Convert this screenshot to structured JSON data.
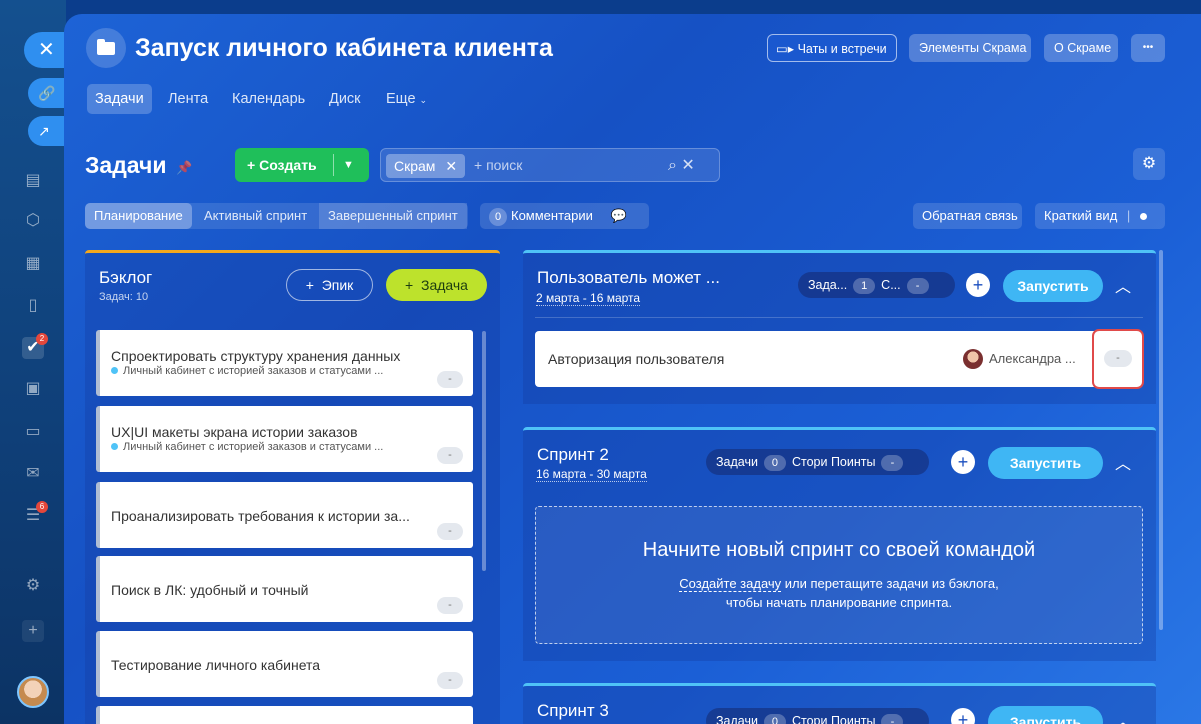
{
  "rail": {
    "chat_badge": "2",
    "feed_badge": "6"
  },
  "header": {
    "title": "Запуск личного кабинета клиента",
    "chats_btn": "Чаты и встречи",
    "scrum_elements_btn": "Элементы Скрама",
    "about_scrum_btn": "О Скраме",
    "more_btn": "•••"
  },
  "tabs": [
    {
      "label": "Задачи"
    },
    {
      "label": "Лента"
    },
    {
      "label": "Календарь"
    },
    {
      "label": "Диск"
    },
    {
      "label": "Еще"
    }
  ],
  "toolbar": {
    "section_title": "Задачи",
    "create_label": "Создать",
    "filter_chip": "Скрам",
    "search_placeholder": "+ поиск"
  },
  "views": {
    "planning": "Планирование",
    "active_sprint": "Активный спринт",
    "completed_sprint": "Завершенный спринт",
    "comments_count": "0",
    "comments_label": "Комментарии",
    "feedback": "Обратная связь",
    "compact_view": "Краткий вид"
  },
  "backlog": {
    "title": "Бэклог",
    "subtitle": "Задач: 10",
    "epic_btn": "Эпик",
    "task_btn": "Задача",
    "cards": [
      {
        "title": "Спроектировать структуру хранения данных",
        "epic": "Личный кабинет с историей заказов и статусами ...",
        "points": "-"
      },
      {
        "title": "UX|UI макеты экрана истории заказов",
        "epic": "Личный кабинет с историей заказов и статусами ...",
        "points": "-"
      },
      {
        "title": "Проанализировать требования к истории за...",
        "epic": "",
        "points": "-"
      },
      {
        "title": "Поиск в ЛК: удобный и точный",
        "epic": "",
        "points": "-"
      },
      {
        "title": "Тестирование личного кабинета",
        "epic": "",
        "points": "-"
      }
    ]
  },
  "sprints": [
    {
      "title": "Пользователь может ...",
      "dates": "2 марта - 16 марта",
      "tasks_label": "Зада...",
      "tasks_count": "1",
      "points_label": "С...",
      "points_value": "-",
      "run_label": "Запустить",
      "task": {
        "title": "Авторизация пользователя",
        "assignee": "Александра ...",
        "points": "-"
      }
    },
    {
      "title": "Спринт 2",
      "dates": "16 марта - 30 марта",
      "tasks_label": "Задачи",
      "tasks_count": "0",
      "points_label": "Стори Поинты",
      "points_value": "-",
      "run_label": "Запустить",
      "empty_title": "Начните новый спринт со своей командой",
      "empty_link": "Создайте задачу",
      "empty_text1": " или перетащите задачи из бэклога,",
      "empty_text2": "чтобы начать планирование спринта."
    },
    {
      "title": "Спринт 3",
      "tasks_label": "Задачи",
      "tasks_count": "0",
      "points_label": "Стори Поинты",
      "points_value": "-",
      "run_label": "Запустить"
    }
  ]
}
